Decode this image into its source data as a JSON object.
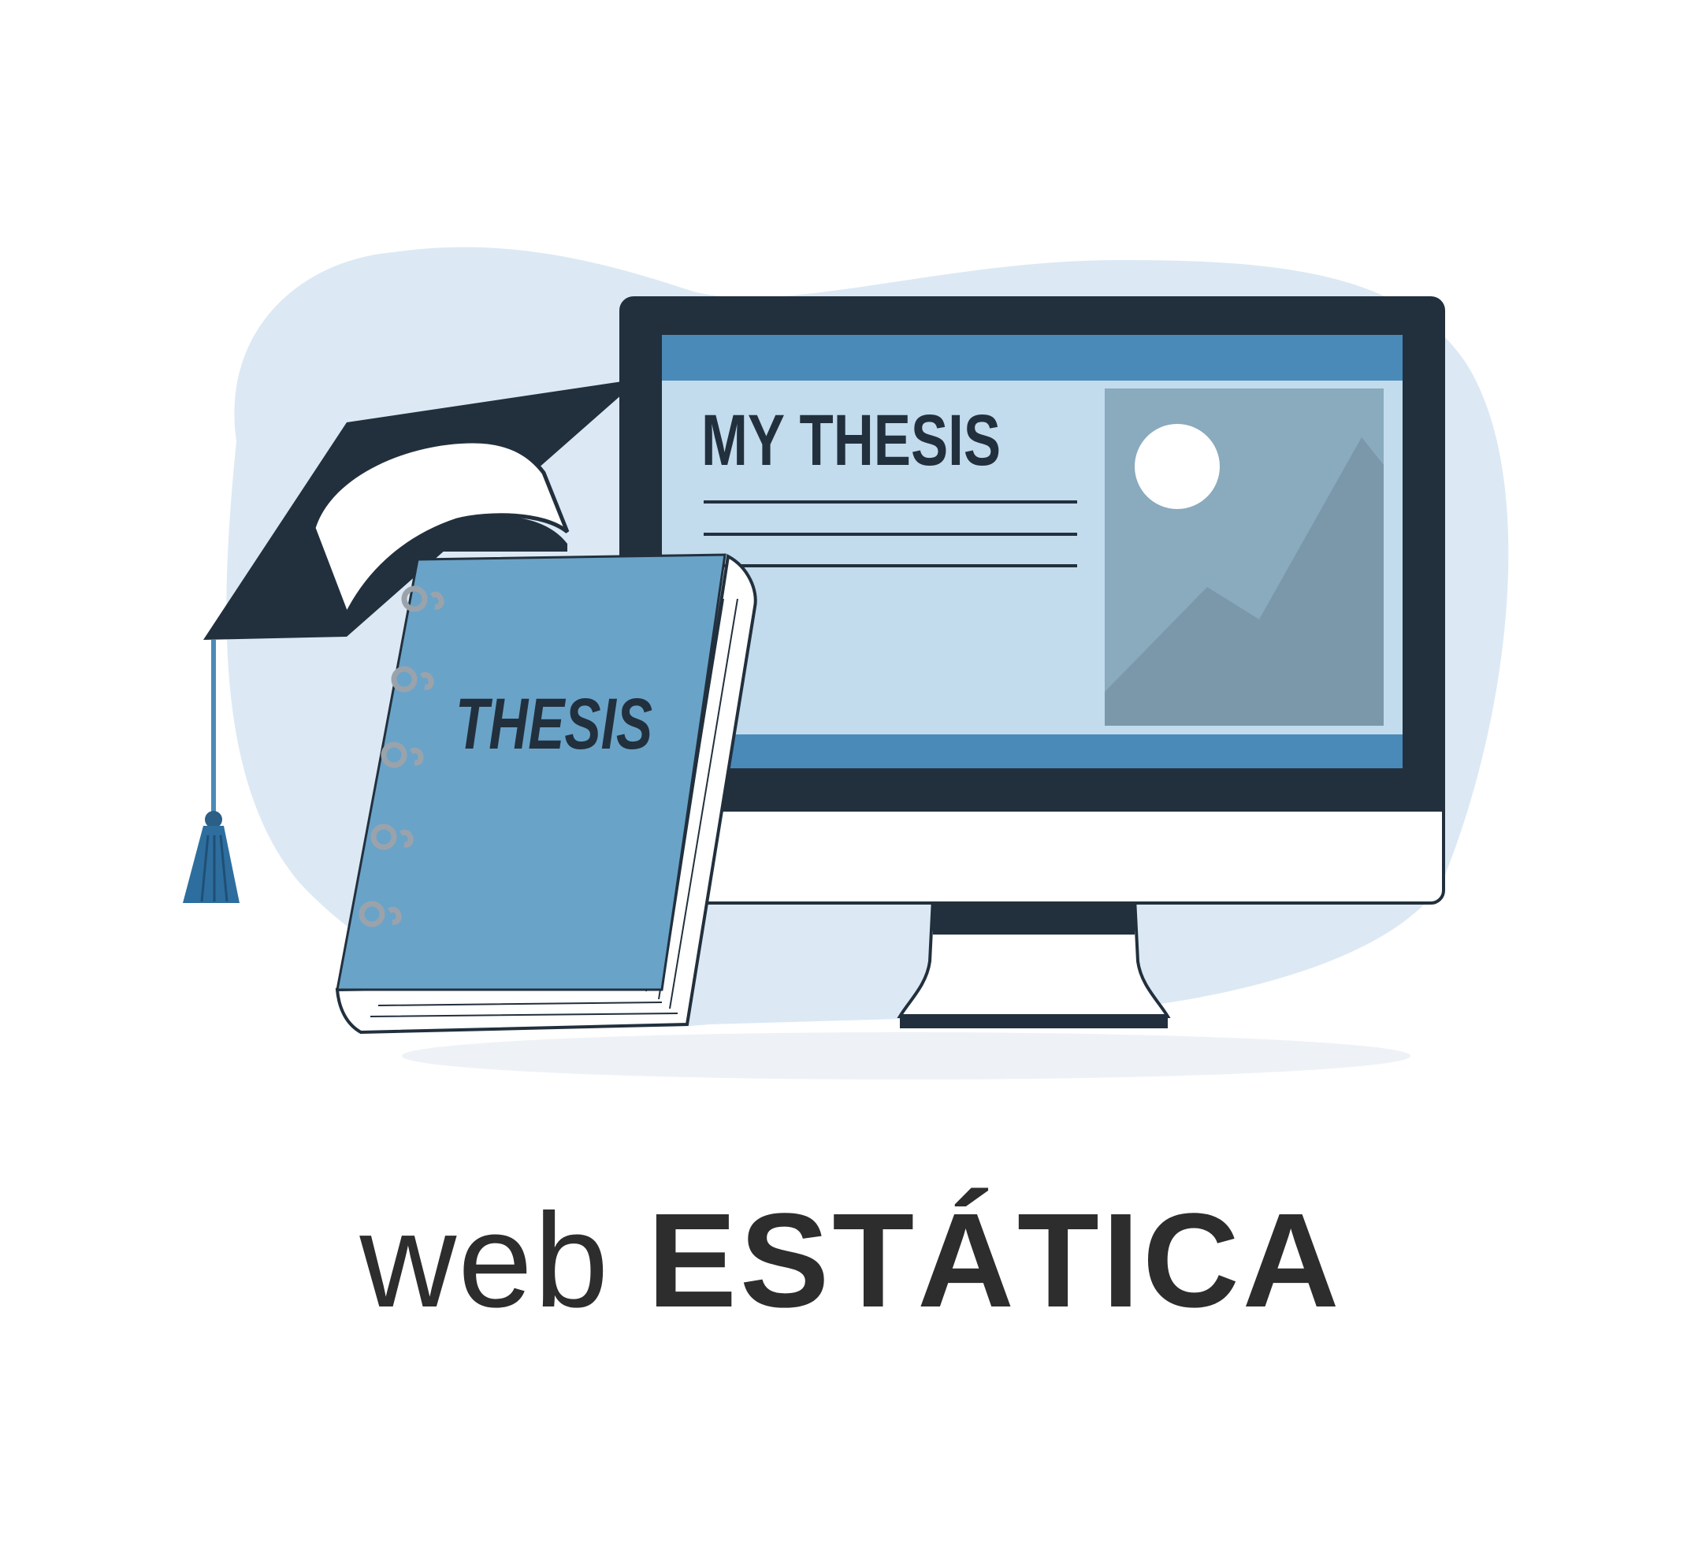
{
  "screen": {
    "title": "MY THESIS"
  },
  "book": {
    "title": "THESIS"
  },
  "caption": {
    "light": "web",
    "bold": "ESTÁTICA"
  },
  "colors": {
    "dark": "#22303d",
    "blue_mid": "#4a8ab8",
    "blue_book": "#6aa3c8",
    "screen_bg": "#c2dbed",
    "image_panel": "#8aaabd",
    "mountain": "#7a98aa",
    "blob": "#dce9f4",
    "text": "#2d2d2d"
  },
  "icons": {
    "cap": "graduation-cap-icon",
    "monitor": "monitor-icon",
    "book": "thesis-book-icon",
    "image": "image-placeholder-icon"
  }
}
